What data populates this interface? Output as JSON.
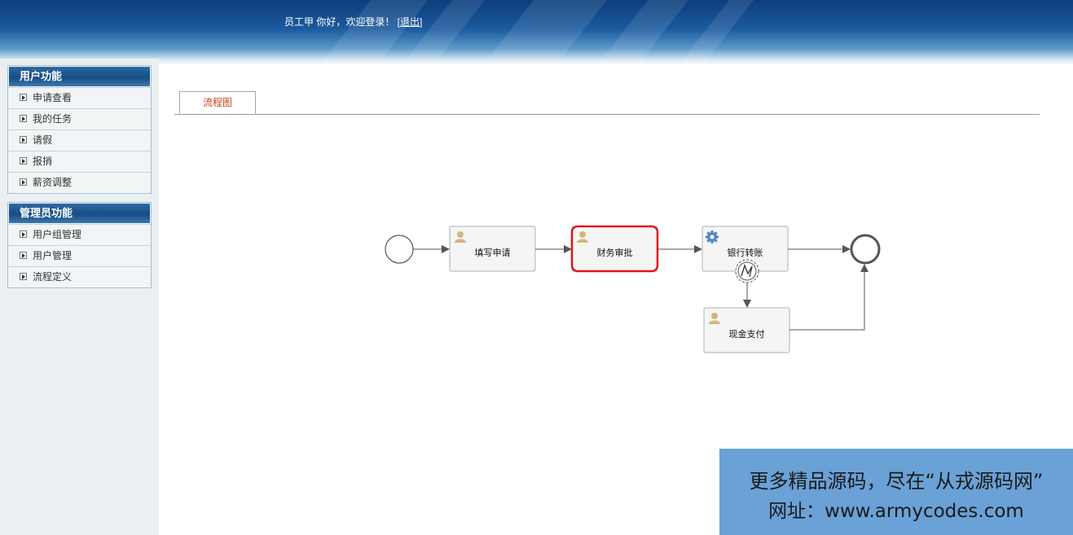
{
  "header": {
    "greeting": "员工甲  你好，欢迎登录！ [",
    "logout": "退出",
    "bracket_close": "]"
  },
  "sidebar": {
    "user_menu": {
      "title": "用户功能",
      "items": [
        "申请查看",
        "我的任务",
        "请假",
        "报捎",
        "薪资调整"
      ]
    },
    "admin_menu": {
      "title": "管理员功能",
      "items": [
        "用户组管理",
        "用户管理",
        "流程定义"
      ]
    }
  },
  "tabs": [
    {
      "label": "流程图",
      "active": true
    }
  ],
  "process": {
    "tasks": {
      "fill_application": "填写申请",
      "finance_approval": "财务审批",
      "bank_transfer": "银行转账",
      "cash_payment": "现金支付"
    },
    "highlighted_task": "财务审批"
  },
  "watermark": {
    "line1": "更多精品源码，尽在“从戎源码网”",
    "line2": "网址：www.armycodes.com"
  },
  "colors": {
    "highlight": "#e0141e",
    "tab_text": "#c8461b",
    "watermark_bg": "#6aa1d6"
  }
}
